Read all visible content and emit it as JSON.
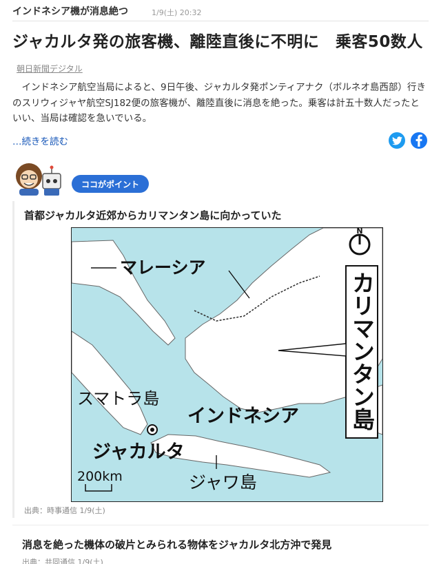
{
  "topic": {
    "label": "インドネシア機が消息絶つ",
    "date": "1/9(土) 20:32"
  },
  "article": {
    "headline": "ジャカルタ発の旅客機、離陸直後に不明に　乗客50数人",
    "source": "朝日新聞デジタル",
    "summary": "インドネシア航空当局によると、9日午後、ジャカルタ発ポンティアナク（ボルネオ島西部）行きのスリウィジャヤ航空SJ182便の旅客機が、離陸直後に消息を絶った。乗客は計五十数人だったといい、当局は確認を急いでいる。",
    "read_more": "…続きを読む"
  },
  "share": {
    "twitter": "twitter-icon",
    "facebook": "facebook-icon",
    "twitter_color": "#1d9bf0",
    "facebook_color": "#1877f2"
  },
  "point": {
    "badge": "ココがポイント"
  },
  "map_card": {
    "title": "首都ジャカルタ近郊からカリマンタン島に向かっていた",
    "labels": {
      "north": "N",
      "malaysia": "マレーシア",
      "kalimantan": "カリマンタン島",
      "sumatra": "スマトラ島",
      "indonesia": "インドネシア",
      "jakarta": "ジャカルタ",
      "scale": "200km",
      "java": "ジャワ島"
    },
    "colors": {
      "sea": "#b7e3ea",
      "land": "#ffffff"
    },
    "credit": "出典：時事通信 1/9(土)"
  },
  "next_item": {
    "title": "消息を絶った機体の破片とみられる物体をジャカルタ北方沖で発見",
    "credit": "出典：共同通信 1/9(土)"
  }
}
